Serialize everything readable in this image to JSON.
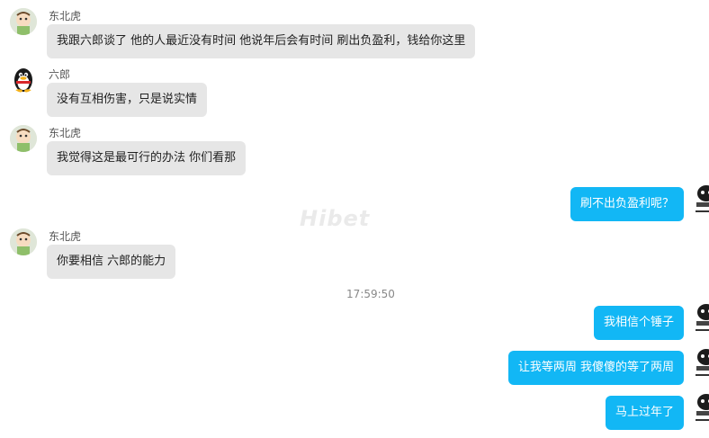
{
  "messages": [
    {
      "sender": "东北虎",
      "text": "我跟六郎谈了 他的人最近没有时间  他说年后会有时间  刷出负盈利，钱给你这里"
    },
    {
      "sender": "六郎",
      "text": "没有互相伤害，只是说实情"
    },
    {
      "sender": "东北虎",
      "text": "我觉得这是最可行的办法 你们看那"
    },
    {
      "sender": "me",
      "text": "刷不出负盈利呢？"
    },
    {
      "sender": "东北虎",
      "text": "你要相信 六郎的能力"
    },
    {
      "timestamp": "17:59:50"
    },
    {
      "sender": "me",
      "text": "我相信个锤子"
    },
    {
      "sender": "me",
      "text": "让我等两周  我傻傻的等了两周"
    },
    {
      "sender": "me",
      "text": "马上过年了"
    }
  ],
  "watermark": "Hibet",
  "colors": {
    "outgoing_bubble": "#12b7f5",
    "incoming_bubble": "#e6e6e6",
    "background": "#ffffff"
  },
  "icons": {
    "dongbeihu_avatar": "cartoon-avatar-icon",
    "liulang_avatar": "qq-penguin-icon",
    "self_avatar": "meme-avatar-icon"
  }
}
